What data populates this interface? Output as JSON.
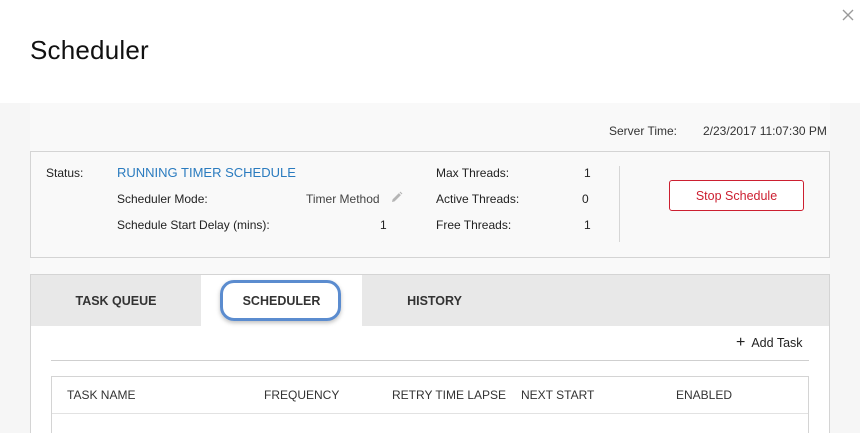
{
  "header": {
    "title": "Scheduler",
    "close_icon": "close-icon"
  },
  "server_time": {
    "label": "Server Time:",
    "value": "2/23/2017 11:07:30 PM"
  },
  "status": {
    "status_label": "Status:",
    "status_value": "RUNNING TIMER SCHEDULE",
    "status_color": "#2a7bbf",
    "mode_label": "Scheduler Mode:",
    "mode_value": "Timer Method",
    "delay_label": "Schedule Start Delay (mins):",
    "delay_value": "1",
    "max_threads_label": "Max Threads:",
    "max_threads_value": "1",
    "active_threads_label": "Active Threads:",
    "active_threads_value": "0",
    "free_threads_label": "Free Threads:",
    "free_threads_value": "1",
    "stop_button_label": "Stop Schedule",
    "stop_button_color": "#cc1f30"
  },
  "tabs": [
    {
      "label": "TASK QUEUE",
      "active": false
    },
    {
      "label": "SCHEDULER",
      "active": true
    },
    {
      "label": "HISTORY",
      "active": false
    }
  ],
  "toolbar": {
    "add_task_label": "Add Task",
    "add_icon": "plus-icon"
  },
  "table": {
    "columns": [
      "TASK NAME",
      "FREQUENCY",
      "RETRY TIME LAPSE",
      "NEXT START",
      "ENABLED"
    ]
  }
}
